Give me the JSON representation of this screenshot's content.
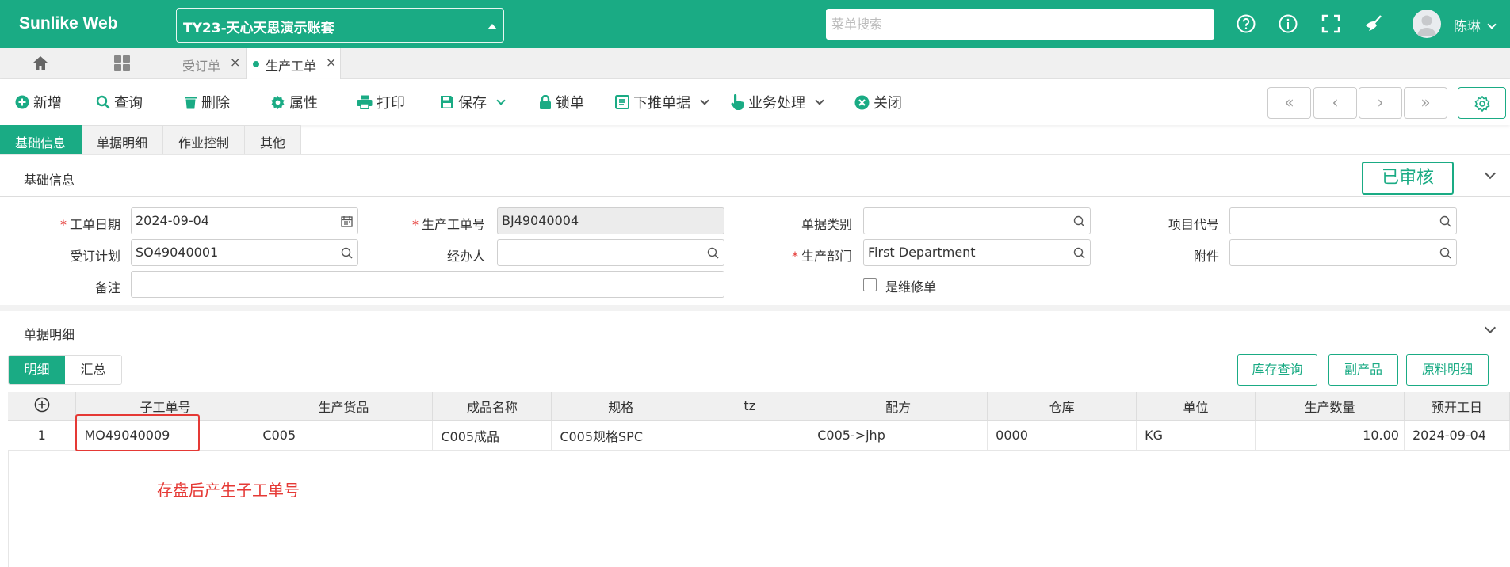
{
  "header": {
    "brand": "Sunlike Web",
    "account": "TY23-天心天思演示账套",
    "search_placeholder": "菜单搜索",
    "user_name": "陈琳"
  },
  "tabs": [
    {
      "label": "受订单",
      "active": false
    },
    {
      "label": "生产工单",
      "active": true
    }
  ],
  "toolbar": {
    "new": "新增",
    "query": "查询",
    "delete": "删除",
    "properties": "属性",
    "print": "打印",
    "save": "保存",
    "lock": "锁单",
    "push_down": "下推单据",
    "business": "业务处理",
    "close": "关闭",
    "first": "«",
    "prev": "‹",
    "next": "›",
    "last": "»"
  },
  "section_tabs": [
    "基础信息",
    "单据明细",
    "作业控制",
    "其他"
  ],
  "basic_info": {
    "title": "基础信息",
    "status_badge": "已审核",
    "fields": {
      "work_date_label": "工单日期",
      "work_date": "2024-09-04",
      "work_no_label": "生产工单号",
      "work_no": "BJ49040004",
      "doc_type_label": "单据类别",
      "doc_type": "",
      "project_label": "项目代号",
      "project": "",
      "order_plan_label": "受订计划",
      "order_plan": "SO49040001",
      "handler_label": "经办人",
      "handler": "",
      "department_label": "生产部门",
      "department": "First Department",
      "attachment_label": "附件",
      "attachment": "",
      "remark_label": "备注",
      "remark": "",
      "repair_label": "是维修单"
    }
  },
  "detail": {
    "title": "单据明细",
    "subtabs": [
      "明细",
      "汇总"
    ],
    "buttons": [
      "库存查询",
      "副产品",
      "原料明细"
    ],
    "columns": [
      "子工单号",
      "生产货品",
      "成品名称",
      "规格",
      "tz",
      "配方",
      "仓库",
      "单位",
      "生产数量",
      "预开工日"
    ],
    "rows": [
      {
        "index": "1",
        "sub_no": "MO49040009",
        "product": "C005",
        "name": "C005成品",
        "spec": "C005规格SPC",
        "tz": "",
        "formula": "C005->jhp",
        "warehouse": "0000",
        "unit": "KG",
        "qty": "10.00",
        "start": "2024-09-04"
      }
    ],
    "annotation": "存盘后产生子工单号"
  },
  "colors": {
    "accent": "#1aab84",
    "annotation": "#e53935"
  }
}
